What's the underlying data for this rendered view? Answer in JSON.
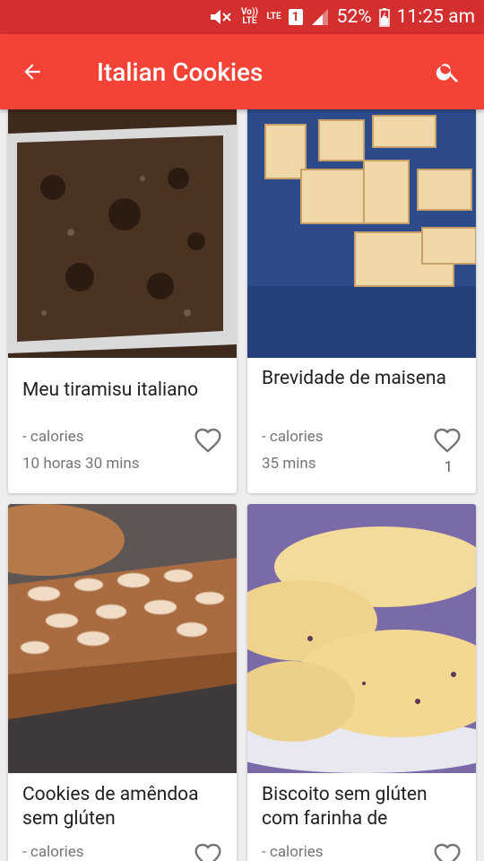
{
  "status_bar": {
    "volte": "Vo)) LTE",
    "lte": "LTE",
    "sim": "1",
    "battery": "52%",
    "time": "11:25 am"
  },
  "app_bar": {
    "title": "Italian Cookies",
    "back_icon": "arrow-back-icon",
    "search_icon": "search-icon"
  },
  "colors": {
    "status_bar": "#d32f2f",
    "app_bar": "#f44336",
    "background": "#eeeeee"
  },
  "recipes": [
    {
      "title": "Meu tiramisu italiano",
      "calories": "- calories",
      "time": "10 horas 30 mins",
      "likes": ""
    },
    {
      "title": "Brevidade de maisena",
      "calories": "- calories",
      "time": "35 mins",
      "likes": "1"
    },
    {
      "title": "Cookies de amêndoa sem glúten",
      "calories": "- calories",
      "time": "",
      "likes": ""
    },
    {
      "title": "Biscoito sem glúten com farinha de",
      "calories": "- calories",
      "time": "",
      "likes": ""
    }
  ]
}
